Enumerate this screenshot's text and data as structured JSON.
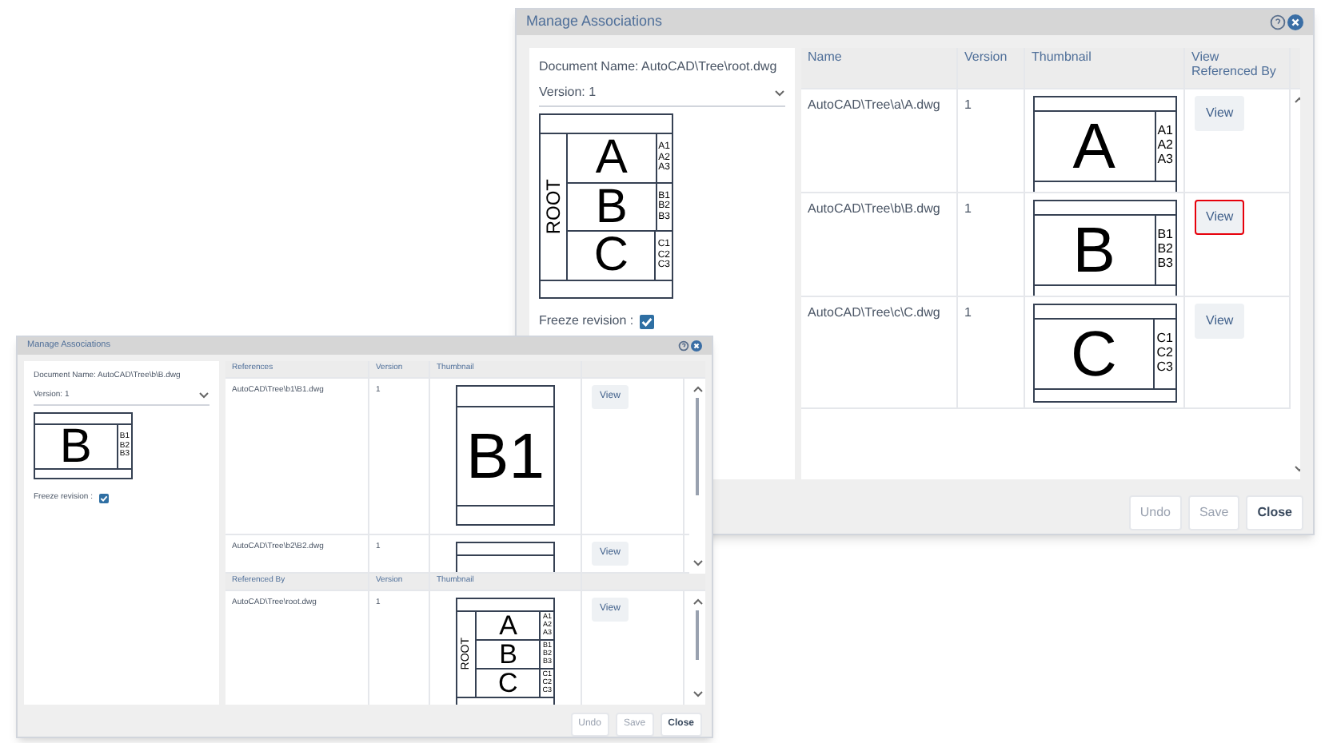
{
  "windows": [
    {
      "title": "Manage Associations",
      "document_name": "Document Name: AutoCAD\\Tree\\root.dwg",
      "version": "Version: 1",
      "preview": {
        "kind": "tree",
        "title": "ROOT",
        "rows": [
          {
            "letter": "A",
            "labels": [
              "A1",
              "A2",
              "A3"
            ]
          },
          {
            "letter": "B",
            "labels": [
              "B1",
              "B2",
              "B3"
            ]
          },
          {
            "letter": "C",
            "labels": [
              "C1",
              "C2",
              "C3"
            ]
          }
        ]
      },
      "freeze_label": "Freeze revision :",
      "freeze_checked": true,
      "tables": [
        {
          "columns": [
            "Name",
            "Version",
            "Thumbnail",
            "View Referenced By"
          ],
          "rows": [
            {
              "name": "AutoCAD\\Tree\\a\\A.dwg",
              "version": "1",
              "thumbnail": {
                "kind": "single",
                "letter": "A",
                "labels": [
                  "A1",
                  "A2",
                  "A3"
                ]
              },
              "button": "View",
              "highlighted": false
            },
            {
              "name": "AutoCAD\\Tree\\b\\B.dwg",
              "version": "1",
              "thumbnail": {
                "kind": "single",
                "letter": "B",
                "labels": [
                  "B1",
                  "B2",
                  "B3"
                ]
              },
              "button": "View",
              "highlighted": true
            },
            {
              "name": "AutoCAD\\Tree\\c\\C.dwg",
              "version": "1",
              "thumbnail": {
                "kind": "single",
                "letter": "C",
                "labels": [
                  "C1",
                  "C2",
                  "C3"
                ]
              },
              "button": "View",
              "highlighted": false
            }
          ]
        }
      ],
      "buttons": [
        {
          "label": "Undo",
          "disabled": true
        },
        {
          "label": "Save",
          "disabled": true
        },
        {
          "label": "Close",
          "disabled": false
        }
      ]
    },
    {
      "title": "Manage Associations",
      "document_name": "Document Name: AutoCAD\\Tree\\b\\B.dwg",
      "version": "Version: 1",
      "preview": {
        "kind": "single",
        "letter": "B",
        "labels": [
          "B1",
          "B2",
          "B3"
        ]
      },
      "freeze_label": "Freeze revision :",
      "freeze_checked": true,
      "tables": [
        {
          "columns": [
            "References",
            "Version",
            "Thumbnail"
          ],
          "rows": [
            {
              "name": "AutoCAD\\Tree\\b1\\B1.dwg",
              "version": "1",
              "thumbnail": {
                "kind": "single",
                "letter": "B1"
              },
              "button": "View",
              "highlighted": false
            },
            {
              "name": "AutoCAD\\Tree\\b2\\B2.dwg",
              "version": "1",
              "thumbnail": {
                "kind": "blank"
              },
              "button": "View",
              "highlighted": false
            }
          ]
        },
        {
          "columns": [
            "Referenced By",
            "Version",
            "Thumbnail"
          ],
          "rows": [
            {
              "name": "AutoCAD\\Tree\\root.dwg",
              "version": "1",
              "thumbnail": {
                "kind": "tree",
                "title": "ROOT",
                "rows": [
                  {
                    "letter": "A",
                    "labels": [
                      "A1",
                      "A2",
                      "A3"
                    ]
                  },
                  {
                    "letter": "B",
                    "labels": [
                      "B1",
                      "B2",
                      "B3"
                    ]
                  },
                  {
                    "letter": "C",
                    "labels": [
                      "C1",
                      "C2",
                      "C3"
                    ]
                  }
                ]
              },
              "button": "View",
              "highlighted": false
            }
          ]
        }
      ],
      "buttons": [
        {
          "label": "Undo",
          "disabled": true
        },
        {
          "label": "Save",
          "disabled": true
        },
        {
          "label": "Close",
          "disabled": false
        }
      ]
    }
  ]
}
